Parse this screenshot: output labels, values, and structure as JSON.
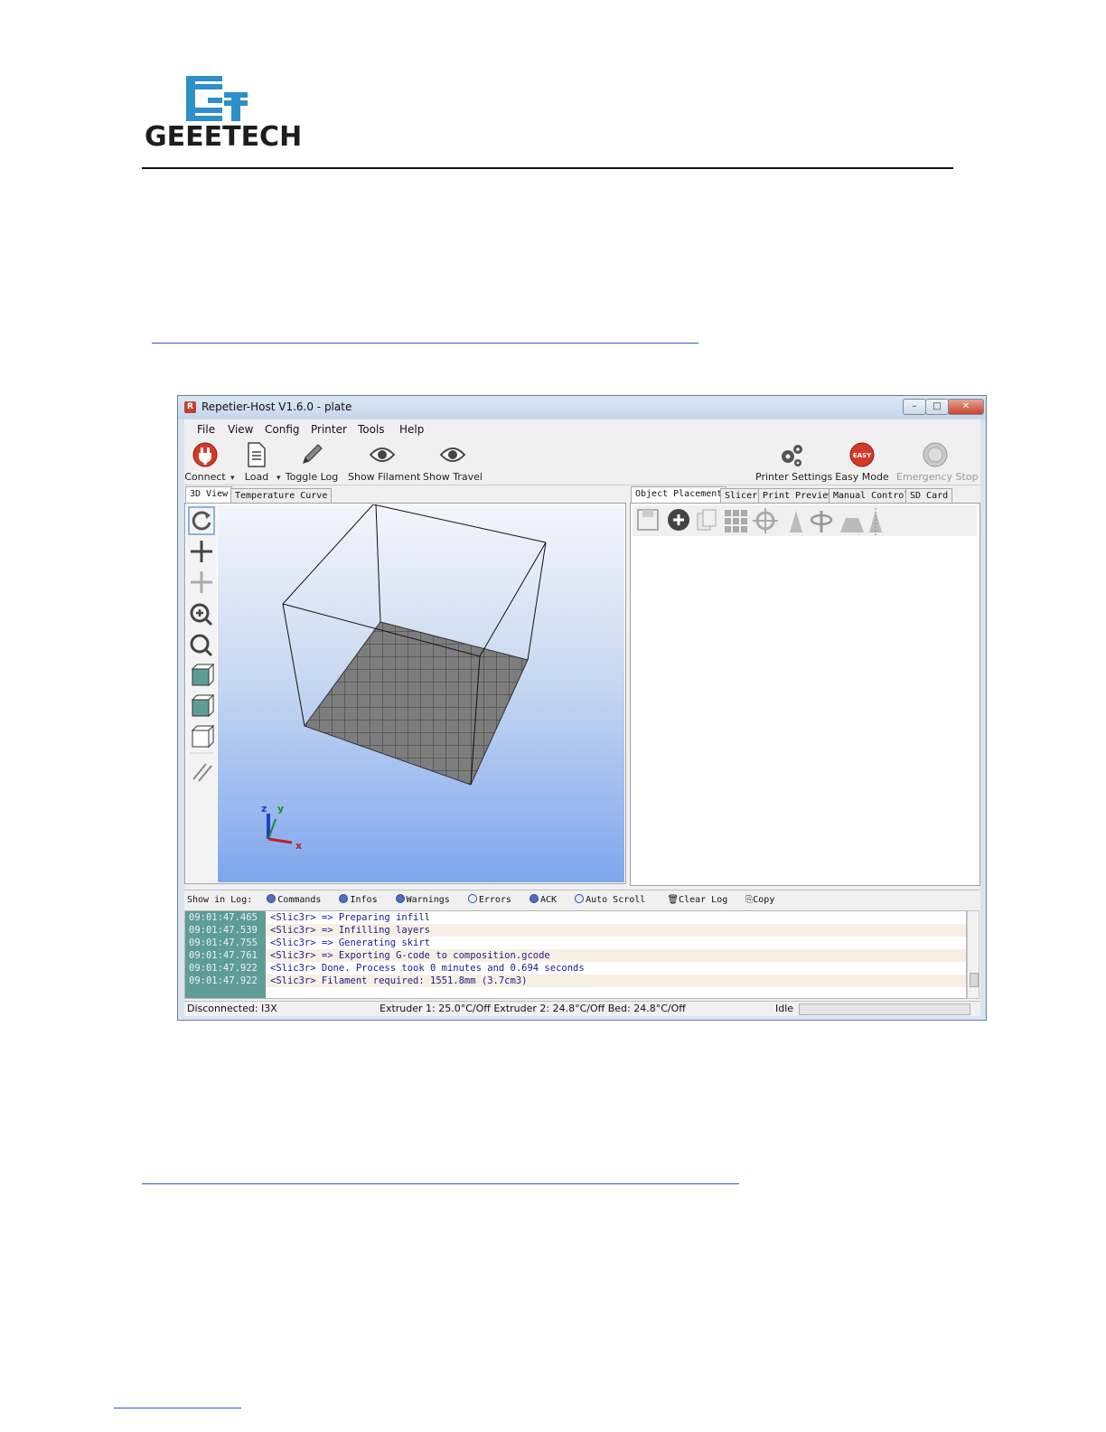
{
  "document": {
    "brand": "GEEETECH"
  },
  "window": {
    "title": "Repetier-Host V1.6.0 - plate",
    "icon_text": "R",
    "controls": {
      "minimize": "–",
      "maximize": "□",
      "close": "✕"
    }
  },
  "menu": [
    "File",
    "View",
    "Config",
    "Printer",
    "Tools",
    "Help"
  ],
  "toolbar": {
    "connect": "Connect",
    "load": "Load",
    "toggle_log": "Toggle Log",
    "show_filament": "Show Filament",
    "show_travel": "Show Travel",
    "printer_settings": "Printer Settings",
    "easy_mode": "Easy Mode",
    "easy_badge": "EASY",
    "emergency_stop": "Emergency Stop",
    "dropdown_glyph": "▾"
  },
  "left_tabs": [
    "3D View",
    "Temperature Curve"
  ],
  "right_tabs": [
    "Object Placement",
    "Slicer",
    "Print Preview",
    "Manual Control",
    "SD Card"
  ],
  "axes": {
    "z": "z",
    "y": "y",
    "x": "x"
  },
  "log": {
    "show_in_log": "Show in Log:",
    "filters": [
      {
        "label": "Commands",
        "on": true
      },
      {
        "label": "Infos",
        "on": true
      },
      {
        "label": "Warnings",
        "on": true
      },
      {
        "label": "Errors",
        "on": false
      },
      {
        "label": "ACK",
        "on": true
      },
      {
        "label": "Auto Scroll",
        "on": false
      }
    ],
    "clear_log": "Clear Log",
    "copy": "Copy",
    "entries": [
      {
        "time": "09:01:47.465",
        "msg": "<Slic3r> => Preparing infill"
      },
      {
        "time": "09:01:47.539",
        "msg": "<Slic3r> => Infilling layers"
      },
      {
        "time": "09:01:47.755",
        "msg": "<Slic3r> => Generating skirt"
      },
      {
        "time": "09:01:47.761",
        "msg": "<Slic3r> => Exporting G-code to composition.gcode"
      },
      {
        "time": "09:01:47.922",
        "msg": "<Slic3r> Done. Process took 0 minutes and 0.694 seconds"
      },
      {
        "time": "09:01:47.922",
        "msg": "<Slic3r> Filament required: 1551.8mm (3.7cm3)"
      }
    ]
  },
  "status": {
    "connection": "Disconnected: I3X",
    "temps": "Extruder 1: 25.0°C/Off Extruder 2: 24.8°C/Off Bed: 24.8°C/Off",
    "state": "Idle"
  },
  "colors": {
    "accent": "#5f9c96",
    "connect_red": "#d23a2a"
  }
}
